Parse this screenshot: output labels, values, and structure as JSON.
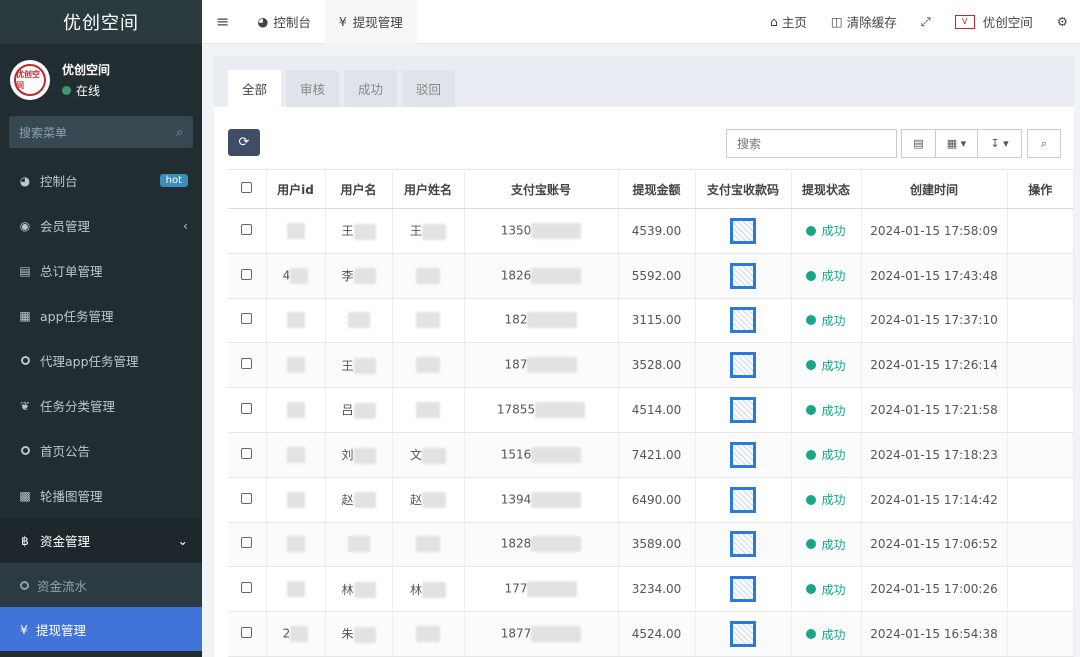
{
  "sidebar": {
    "title": "优创空间",
    "user": {
      "name": "优创空间",
      "status": "在线",
      "avatar_text": "优创空间"
    },
    "search_placeholder": "搜索菜单",
    "items": [
      {
        "label": "控制台",
        "icon": "dashboard-icon",
        "badge": "hot"
      },
      {
        "label": "会员管理",
        "icon": "user-circle-icon"
      },
      {
        "label": "总订单管理",
        "icon": "file-icon"
      },
      {
        "label": "app任务管理",
        "icon": "list-alt-icon"
      },
      {
        "label": "代理app任务管理",
        "icon": "circle-icon"
      },
      {
        "label": "任务分类管理",
        "icon": "leaf-icon"
      },
      {
        "label": "首页公告",
        "icon": "circle-icon"
      },
      {
        "label": "轮播图管理",
        "icon": "film-icon"
      },
      {
        "label": "资金管理",
        "icon": "bitcoin-icon"
      }
    ],
    "subitems": [
      {
        "label": "资金流水"
      },
      {
        "label": "提现管理"
      }
    ]
  },
  "topnav": {
    "menu_icon": "≡",
    "tabs": [
      {
        "label": "控制台",
        "icon": "dashboard-icon"
      },
      {
        "label": "提现管理",
        "icon": "yen-icon"
      }
    ],
    "home": "主页",
    "clear_cache": "清除缓存",
    "brand": "优创空间"
  },
  "panel": {
    "tabs": [
      "全部",
      "审核",
      "成功",
      "驳回"
    ],
    "search_placeholder": "搜索"
  },
  "table": {
    "headers": [
      "用户id",
      "用户名",
      "用户姓名",
      "支付宝账号",
      "提现金额",
      "支付宝收款码",
      "提现状态",
      "创建时间",
      "操作"
    ],
    "rows": [
      {
        "uid": "",
        "username": "王",
        "realname": "王",
        "account": "1350",
        "amount": "4539.00",
        "status": "成功",
        "time": "2024-01-15 17:58:09"
      },
      {
        "uid": "4",
        "username": "李",
        "realname": "",
        "account": "1826",
        "amount": "5592.00",
        "status": "成功",
        "time": "2024-01-15 17:43:48"
      },
      {
        "uid": "",
        "username": "",
        "realname": "",
        "account": "182",
        "amount": "3115.00",
        "status": "成功",
        "time": "2024-01-15 17:37:10"
      },
      {
        "uid": "",
        "username": "王",
        "realname": "",
        "account": "187",
        "amount": "3528.00",
        "status": "成功",
        "time": "2024-01-15 17:26:14"
      },
      {
        "uid": "",
        "username": "吕",
        "realname": "",
        "account": "17855",
        "amount": "4514.00",
        "status": "成功",
        "time": "2024-01-15 17:21:58"
      },
      {
        "uid": "",
        "username": "刘",
        "realname": "文",
        "account": "1516",
        "amount": "7421.00",
        "status": "成功",
        "time": "2024-01-15 17:18:23"
      },
      {
        "uid": "",
        "username": "赵",
        "realname": "赵",
        "account": "1394",
        "amount": "6490.00",
        "status": "成功",
        "time": "2024-01-15 17:14:42"
      },
      {
        "uid": "",
        "username": "",
        "realname": "",
        "account": "1828",
        "amount": "3589.00",
        "status": "成功",
        "time": "2024-01-15 17:06:52"
      },
      {
        "uid": "",
        "username": "林",
        "realname": "林",
        "account": "177",
        "amount": "3234.00",
        "status": "成功",
        "time": "2024-01-15 17:00:26"
      },
      {
        "uid": "2",
        "username": "朱",
        "realname": "",
        "account": "1877",
        "amount": "4524.00",
        "status": "成功",
        "time": "2024-01-15 16:54:38"
      }
    ]
  }
}
